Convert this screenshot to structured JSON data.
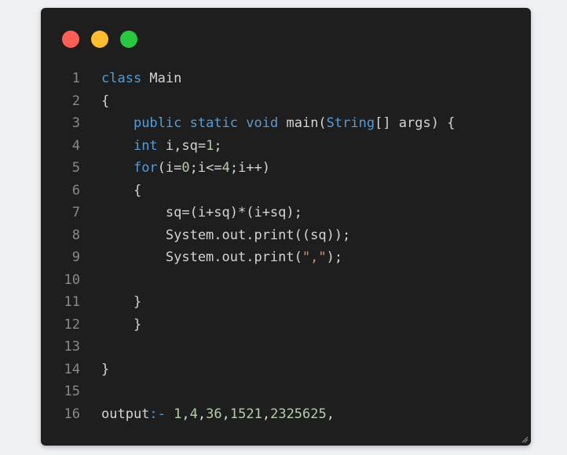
{
  "window": {
    "traffic_lights": [
      {
        "name": "close",
        "color": "#ff5f57"
      },
      {
        "name": "minimize",
        "color": "#febc2e"
      },
      {
        "name": "maximize",
        "color": "#28c840"
      }
    ],
    "background": "#1e1e1e"
  },
  "colors": {
    "keyword": "#569cd6",
    "plain": "#d4d4d4",
    "number": "#b5cea8",
    "string": "#ce9178",
    "line_number": "#8a8a8a"
  },
  "lines": [
    {
      "number": "1",
      "tokens": [
        {
          "t": "class",
          "c": "keyword"
        },
        {
          "t": " Main",
          "c": "plain"
        }
      ]
    },
    {
      "number": "2",
      "tokens": [
        {
          "t": "{",
          "c": "plain"
        }
      ]
    },
    {
      "number": "3",
      "tokens": [
        {
          "t": "    ",
          "c": "plain"
        },
        {
          "t": "public",
          "c": "keyword"
        },
        {
          "t": " ",
          "c": "plain"
        },
        {
          "t": "static",
          "c": "keyword"
        },
        {
          "t": " ",
          "c": "plain"
        },
        {
          "t": "void",
          "c": "keyword"
        },
        {
          "t": " main(",
          "c": "plain"
        },
        {
          "t": "String",
          "c": "keyword"
        },
        {
          "t": "[] args) {",
          "c": "plain"
        }
      ]
    },
    {
      "number": "4",
      "tokens": [
        {
          "t": "    ",
          "c": "plain"
        },
        {
          "t": "int",
          "c": "keyword"
        },
        {
          "t": " i,sq=",
          "c": "plain"
        },
        {
          "t": "1",
          "c": "number"
        },
        {
          "t": ";",
          "c": "plain"
        }
      ]
    },
    {
      "number": "5",
      "tokens": [
        {
          "t": "    ",
          "c": "plain"
        },
        {
          "t": "for",
          "c": "keyword"
        },
        {
          "t": "(i=",
          "c": "plain"
        },
        {
          "t": "0",
          "c": "number"
        },
        {
          "t": ";i<=",
          "c": "plain"
        },
        {
          "t": "4",
          "c": "number"
        },
        {
          "t": ";i++)",
          "c": "plain"
        }
      ]
    },
    {
      "number": "6",
      "tokens": [
        {
          "t": "    {",
          "c": "plain"
        }
      ]
    },
    {
      "number": "7",
      "tokens": [
        {
          "t": "        sq=(i+sq)*(i+sq);",
          "c": "plain"
        }
      ]
    },
    {
      "number": "8",
      "tokens": [
        {
          "t": "        System.out.print((sq));",
          "c": "plain"
        }
      ]
    },
    {
      "number": "9",
      "tokens": [
        {
          "t": "        System.out.print(",
          "c": "plain"
        },
        {
          "t": "\",\"",
          "c": "string"
        },
        {
          "t": ");",
          "c": "plain"
        }
      ]
    },
    {
      "number": "10",
      "tokens": []
    },
    {
      "number": "11",
      "tokens": [
        {
          "t": "    }",
          "c": "plain"
        }
      ]
    },
    {
      "number": "12",
      "tokens": [
        {
          "t": "    }",
          "c": "plain"
        }
      ]
    },
    {
      "number": "13",
      "tokens": []
    },
    {
      "number": "14",
      "tokens": [
        {
          "t": "}",
          "c": "plain"
        }
      ]
    },
    {
      "number": "15",
      "tokens": []
    },
    {
      "number": "16",
      "tokens": [
        {
          "t": "output",
          "c": "plain"
        },
        {
          "t": ":-",
          "c": "keyword"
        },
        {
          "t": " ",
          "c": "plain"
        },
        {
          "t": "1",
          "c": "number"
        },
        {
          "t": ",",
          "c": "plain"
        },
        {
          "t": "4",
          "c": "number"
        },
        {
          "t": ",",
          "c": "plain"
        },
        {
          "t": "36",
          "c": "number"
        },
        {
          "t": ",",
          "c": "plain"
        },
        {
          "t": "1521",
          "c": "number"
        },
        {
          "t": ",",
          "c": "plain"
        },
        {
          "t": "2325625",
          "c": "number"
        },
        {
          "t": ",",
          "c": "plain"
        }
      ]
    }
  ]
}
